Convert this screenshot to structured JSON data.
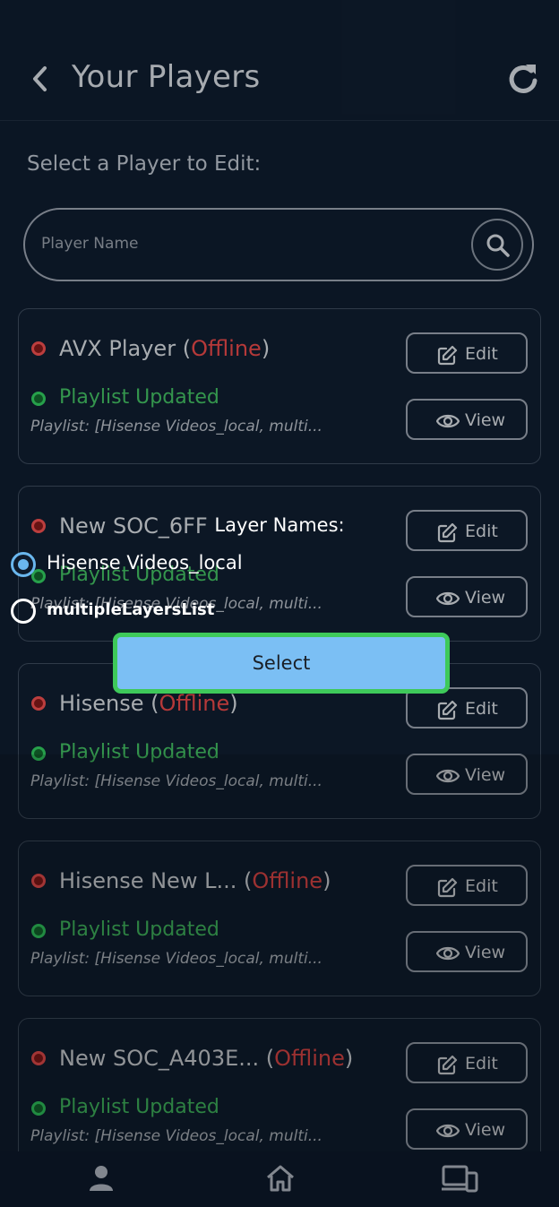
{
  "header": {
    "title": "Your Players"
  },
  "subtitle": "Select a Player to Edit:",
  "search": {
    "placeholder": "Player Name"
  },
  "edit_label": "Edit",
  "view_label": "View",
  "players": [
    {
      "name": "AVX Player",
      "status": "Offline",
      "playlist_status": "Playlist Updated",
      "playlist": "Playlist: [Hisense Videos_local, multi..."
    },
    {
      "name": "New SOC_6FF",
      "status": "",
      "playlist_status": "Playlist Updated",
      "playlist": "Playlist: [Hisense Videos_local, multi..."
    },
    {
      "name": "Hisense",
      "status": "Offline",
      "playlist_status": "Playlist Updated",
      "playlist": "Playlist: [Hisense Videos_local, multi..."
    },
    {
      "name": "Hisense New L...",
      "status": "Offline",
      "playlist_status": "Playlist Updated",
      "playlist": "Playlist: [Hisense Videos_local, multi..."
    },
    {
      "name": "New SOC_A403E...",
      "status": "Offline",
      "playlist_status": "Playlist Updated",
      "playlist": "Playlist: [Hisense Videos_local, multi..."
    }
  ],
  "modal": {
    "title": "Layer Names:",
    "options": [
      {
        "label": "Hisense Videos_local",
        "selected": true
      },
      {
        "label": "multipleLayersList",
        "selected": false
      }
    ],
    "select_label": "Select"
  },
  "nav": {
    "items": [
      "profile-icon",
      "home-icon",
      "devices-icon"
    ]
  },
  "colors": {
    "background": "#0e1b2c",
    "offline": "#d84444",
    "online": "#3fb35c",
    "select_button": "#7bbff4",
    "select_border": "#3ec95a"
  }
}
